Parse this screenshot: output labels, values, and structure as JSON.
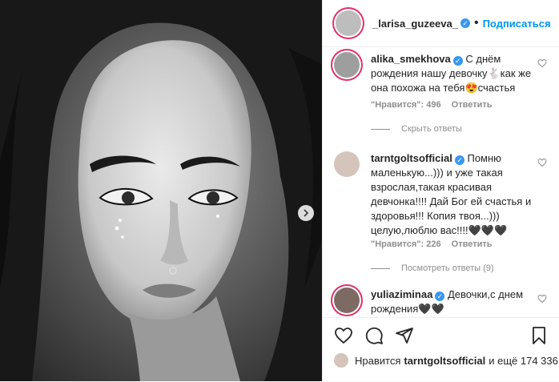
{
  "post": {
    "author": "_larisa_guzeeva_",
    "follow_label": "Подписаться",
    "separator": "•"
  },
  "comments": [
    {
      "user": "alika_smekhova",
      "text": "С днём рождения нашу девочку🐇как же она похожа на тебя😍счастья",
      "likes_label": "\"Нравится\": 496",
      "reply_label": "Ответить",
      "replies_label": "Скрыть ответы"
    },
    {
      "user": "tarntgoltsofficial",
      "text": "Помню маленькую...))) и уже такая взрослая,такая красивая девчонка!!!! Дай Бог ей счастья и здоровья!!! Копия твоя...))) целую,люблю вас!!!!🖤🖤🖤",
      "likes_label": "\"Нравится\": 226",
      "reply_label": "Ответить",
      "replies_label": "Посмотреть ответы (9)"
    },
    {
      "user": "yuliaziminaa",
      "text": "Девочки,с днем рождения🖤🖤"
    }
  ],
  "likes": {
    "prefix": "Нравится",
    "user": "tarntgoltsofficial",
    "suffix": "и ещё 174 336"
  },
  "icons": [
    "heart-icon",
    "comment-icon",
    "share-icon",
    "bookmark-icon",
    "next-arrow-icon",
    "verified-icon"
  ]
}
